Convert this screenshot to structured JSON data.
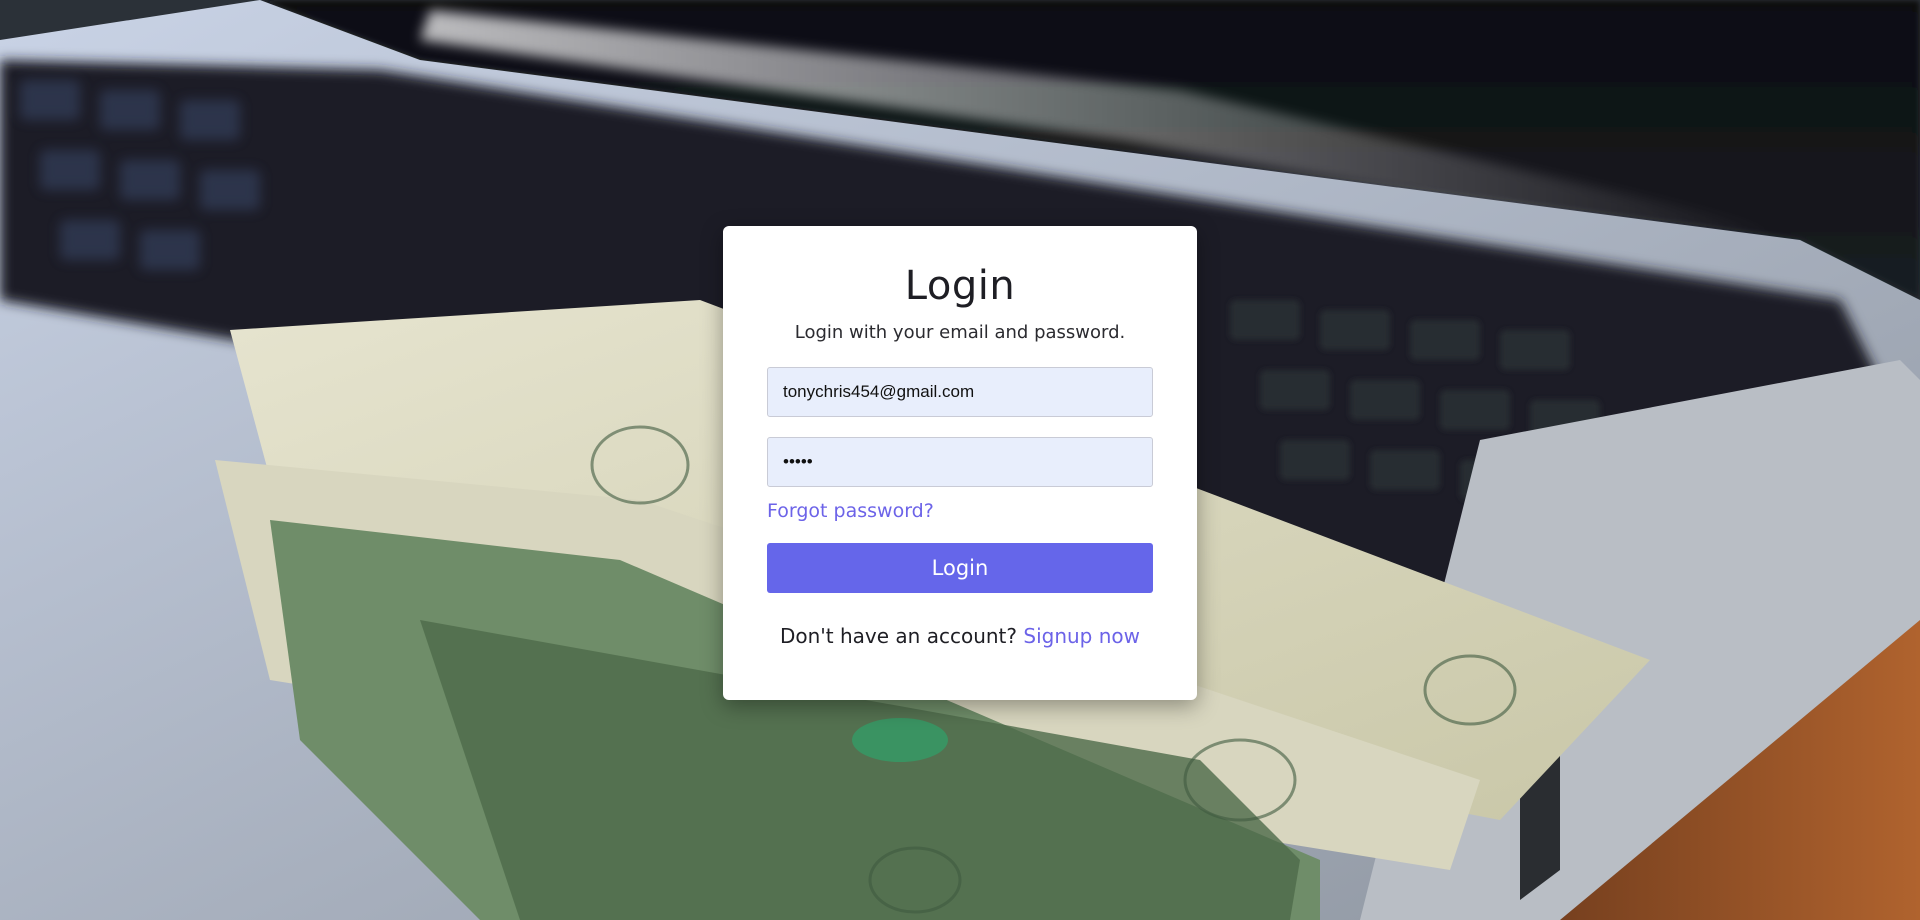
{
  "login": {
    "title": "Login",
    "subtitle": "Login with your email and password.",
    "email_value": "tonychris454@gmail.com",
    "password_value": "•••••",
    "forgot_label": "Forgot password?",
    "button_label": "Login",
    "signup_prompt": "Don't have an account?",
    "signup_link": "Signup now"
  },
  "colors": {
    "accent": "#6566ea",
    "link": "#6c63e8",
    "field_bg": "#e8eefc",
    "card_bg": "#ffffff"
  }
}
